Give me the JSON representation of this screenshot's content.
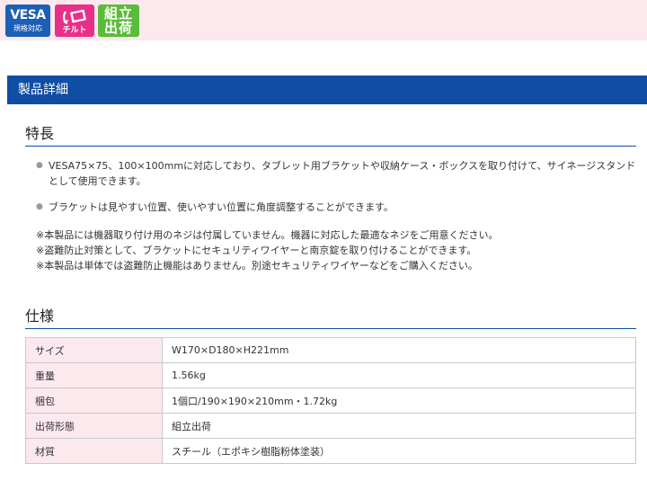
{
  "badges": {
    "vesa_main": "VESA",
    "vesa_sub": "規格対応",
    "tilt_sub": "チルト",
    "assemble_line1": "組立",
    "assemble_line2": "出荷"
  },
  "section_title": "製品詳細",
  "features": {
    "heading": "特長",
    "items": [
      "VESA75×75、100×100mmに対応しており、タブレット用ブラケットや収納ケース・ボックスを取り付けて、サイネージスタンドとして使用できます。",
      "ブラケットは見やすい位置、使いやすい位置に角度調整することができます。"
    ],
    "notes": [
      "※本製品には機器取り付け用のネジは付属していません。機器に対応した最適なネジをご用意ください。",
      "※盗難防止対策として、ブラケットにセキュリティワイヤーと南京錠を取り付けることができます。",
      "※本製品は単体では盗難防止機能はありません。別途セキュリティワイヤーなどをご購入ください。"
    ]
  },
  "specs": {
    "heading": "仕様",
    "rows": [
      {
        "key": "サイズ",
        "value": "W170×D180×H221mm"
      },
      {
        "key": "重量",
        "value": "1.56kg"
      },
      {
        "key": "梱包",
        "value": "1個口/190×190×210mm・1.72kg"
      },
      {
        "key": "出荷形態",
        "value": "組立出荷"
      },
      {
        "key": "材質",
        "value": "スチール（エポキシ樹脂粉体塗装）"
      }
    ]
  }
}
